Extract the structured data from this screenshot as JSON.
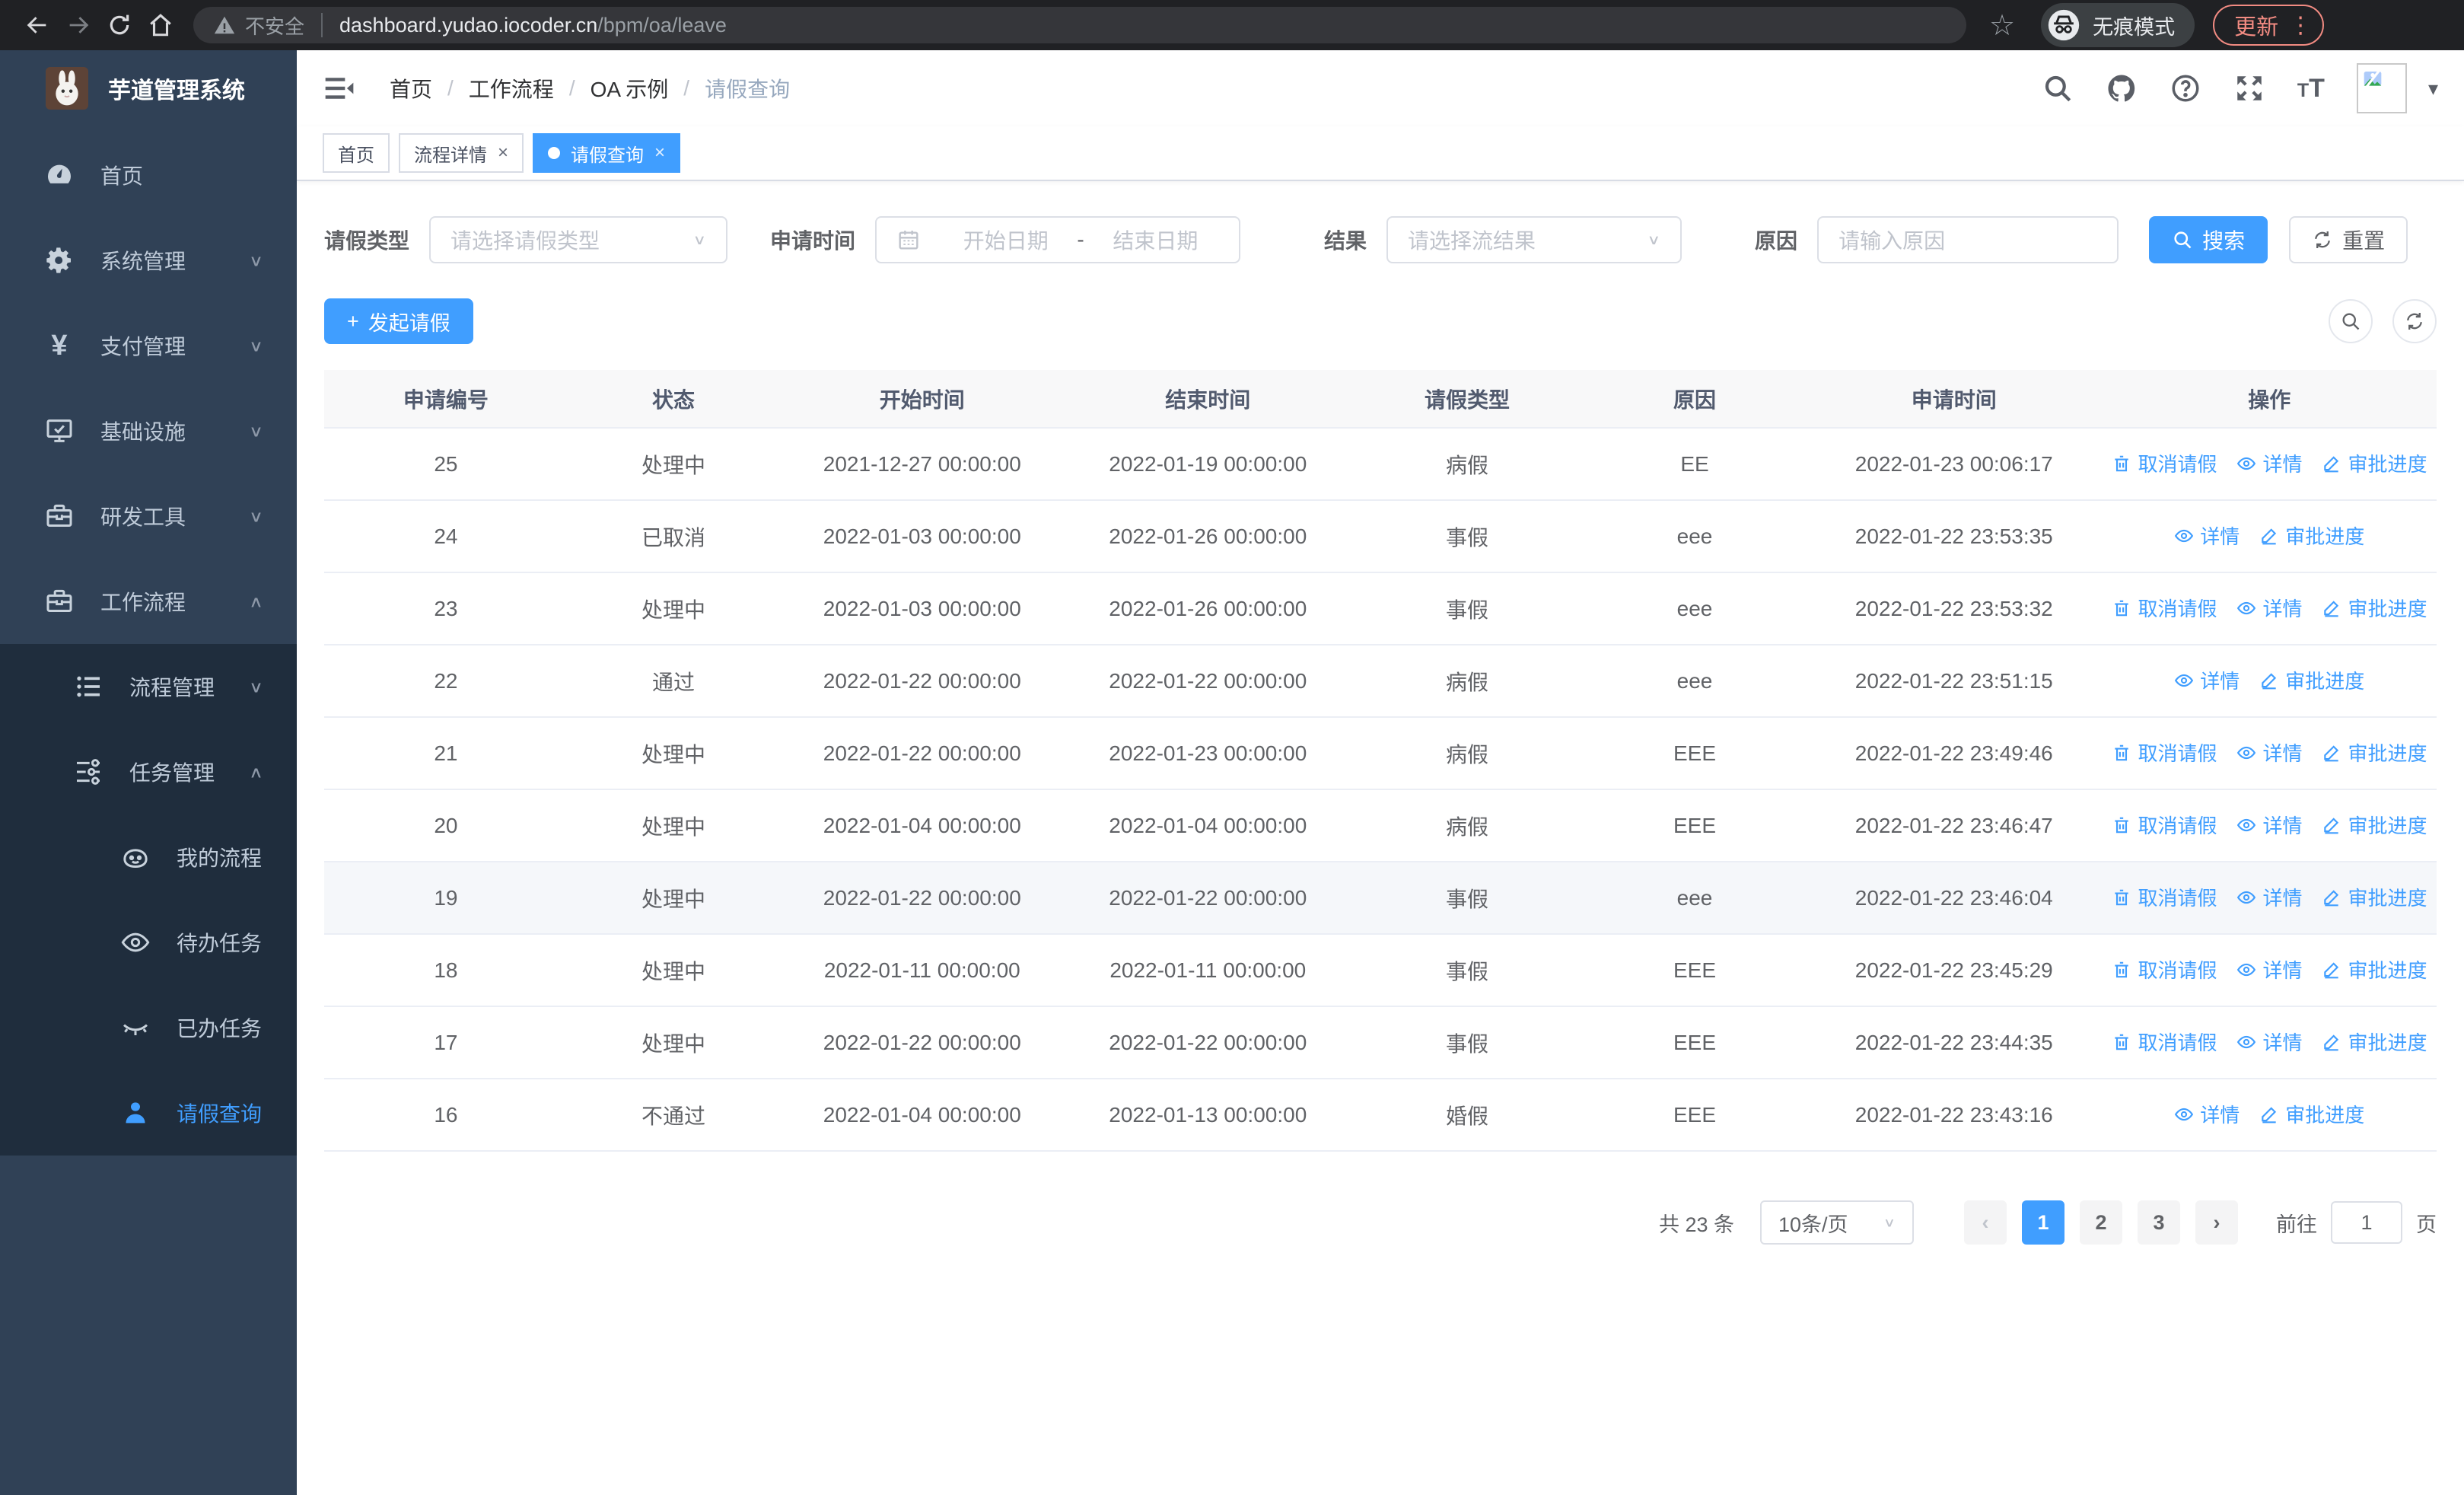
{
  "colors": {
    "accent": "#409eff",
    "sidebar_bg": "#304156",
    "submenu_bg": "#1f2d3d",
    "browser_bg": "#202124",
    "update": "#f28b82",
    "row_hover": "#f5f7fa"
  },
  "browser": {
    "security_label": "不安全",
    "url_host": "dashboard.yudao.iocoder.cn",
    "url_path": "/bpm/oa/leave",
    "incognito_label": "无痕模式",
    "update_label": "更新",
    "icons": [
      "back-icon",
      "forward-icon",
      "reload-icon",
      "home-icon",
      "warning-icon",
      "star-icon",
      "incognito-icon",
      "kebab-menu-icon"
    ]
  },
  "sidebar": {
    "logo_title": "芋道管理系统",
    "logo_icon": "rabbit-logo",
    "items": [
      {
        "label": "首页",
        "icon": "dashboard-icon",
        "depth": 1,
        "arrow": "",
        "sub": false,
        "active": false
      },
      {
        "label": "系统管理",
        "icon": "gear-icon",
        "depth": 1,
        "arrow": "down",
        "sub": false,
        "active": false
      },
      {
        "label": "支付管理",
        "icon": "yen-icon",
        "depth": 1,
        "arrow": "down",
        "sub": false,
        "active": false
      },
      {
        "label": "基础设施",
        "icon": "monitor-icon",
        "depth": 1,
        "arrow": "down",
        "sub": false,
        "active": false
      },
      {
        "label": "研发工具",
        "icon": "toolbox-icon",
        "depth": 1,
        "arrow": "down",
        "sub": false,
        "active": false
      },
      {
        "label": "工作流程",
        "icon": "workflow-icon",
        "depth": 1,
        "arrow": "up",
        "sub": false,
        "active": false
      },
      {
        "label": "流程管理",
        "icon": "process-list-icon",
        "depth": 2,
        "arrow": "down",
        "sub": true,
        "active": false
      },
      {
        "label": "任务管理",
        "icon": "task-flow-icon",
        "depth": 2,
        "arrow": "up",
        "sub": true,
        "active": false
      },
      {
        "label": "我的流程",
        "icon": "robot-face-icon",
        "depth": 3,
        "arrow": "",
        "sub": true,
        "active": false
      },
      {
        "label": "待办任务",
        "icon": "eye-icon",
        "depth": 3,
        "arrow": "",
        "sub": true,
        "active": false
      },
      {
        "label": "已办任务",
        "icon": "eye-closed-icon",
        "depth": 3,
        "arrow": "",
        "sub": true,
        "active": false
      },
      {
        "label": "请假查询",
        "icon": "user-icon",
        "depth": 3,
        "arrow": "",
        "sub": true,
        "active": true
      }
    ]
  },
  "header": {
    "breadcrumb": [
      "首页",
      "工作流程",
      "OA 示例",
      "请假查询"
    ],
    "separator": "/",
    "right_icons": [
      "search-icon",
      "github-icon",
      "help-icon",
      "fullscreen-icon",
      "fontsize-icon",
      "avatar",
      "caret-down-icon"
    ]
  },
  "tabs": [
    {
      "label": "首页",
      "closable": false,
      "active": false
    },
    {
      "label": "流程详情",
      "closable": true,
      "active": false
    },
    {
      "label": "请假查询",
      "closable": true,
      "active": true
    }
  ],
  "filters": {
    "leave_type": {
      "label": "请假类型",
      "placeholder": "请选择请假类型"
    },
    "apply_time": {
      "label": "申请时间",
      "start_placeholder": "开始日期",
      "separator": "-",
      "end_placeholder": "结束日期"
    },
    "result": {
      "label": "结果",
      "placeholder": "请选择流结果"
    },
    "reason": {
      "label": "原因",
      "placeholder": "请输入原因"
    },
    "search_label": "搜索",
    "reset_label": "重置"
  },
  "toolbar": {
    "create_label": "发起请假",
    "plus": "+",
    "icons": [
      "search-circle-icon",
      "refresh-circle-icon"
    ]
  },
  "table": {
    "columns": [
      "申请编号",
      "状态",
      "开始时间",
      "结束时间",
      "请假类型",
      "原因",
      "申请时间",
      "操作"
    ],
    "action_labels": {
      "cancel": "取消请假",
      "detail": "详情",
      "progress": "审批进度"
    },
    "action_icons": {
      "cancel": "trash-icon",
      "detail": "view-eye-icon",
      "progress": "edit-pen-icon"
    },
    "rows": [
      {
        "id": "25",
        "status": "处理中",
        "start": "2021-12-27 00:00:00",
        "end": "2022-01-19 00:00:00",
        "type": "病假",
        "reason": "EE",
        "apply": "2022-01-23 00:06:17",
        "actions": [
          "cancel",
          "detail",
          "progress"
        ],
        "hovered": false
      },
      {
        "id": "24",
        "status": "已取消",
        "start": "2022-01-03 00:00:00",
        "end": "2022-01-26 00:00:00",
        "type": "事假",
        "reason": "eee",
        "apply": "2022-01-22 23:53:35",
        "actions": [
          "detail",
          "progress"
        ],
        "hovered": false
      },
      {
        "id": "23",
        "status": "处理中",
        "start": "2022-01-03 00:00:00",
        "end": "2022-01-26 00:00:00",
        "type": "事假",
        "reason": "eee",
        "apply": "2022-01-22 23:53:32",
        "actions": [
          "cancel",
          "detail",
          "progress"
        ],
        "hovered": false
      },
      {
        "id": "22",
        "status": "通过",
        "start": "2022-01-22 00:00:00",
        "end": "2022-01-22 00:00:00",
        "type": "病假",
        "reason": "eee",
        "apply": "2022-01-22 23:51:15",
        "actions": [
          "detail",
          "progress"
        ],
        "hovered": false
      },
      {
        "id": "21",
        "status": "处理中",
        "start": "2022-01-22 00:00:00",
        "end": "2022-01-23 00:00:00",
        "type": "病假",
        "reason": "EEE",
        "apply": "2022-01-22 23:49:46",
        "actions": [
          "cancel",
          "detail",
          "progress"
        ],
        "hovered": false
      },
      {
        "id": "20",
        "status": "处理中",
        "start": "2022-01-04 00:00:00",
        "end": "2022-01-04 00:00:00",
        "type": "病假",
        "reason": "EEE",
        "apply": "2022-01-22 23:46:47",
        "actions": [
          "cancel",
          "detail",
          "progress"
        ],
        "hovered": false
      },
      {
        "id": "19",
        "status": "处理中",
        "start": "2022-01-22 00:00:00",
        "end": "2022-01-22 00:00:00",
        "type": "事假",
        "reason": "eee",
        "apply": "2022-01-22 23:46:04",
        "actions": [
          "cancel",
          "detail",
          "progress"
        ],
        "hovered": true
      },
      {
        "id": "18",
        "status": "处理中",
        "start": "2022-01-11 00:00:00",
        "end": "2022-01-11 00:00:00",
        "type": "事假",
        "reason": "EEE",
        "apply": "2022-01-22 23:45:29",
        "actions": [
          "cancel",
          "detail",
          "progress"
        ],
        "hovered": false
      },
      {
        "id": "17",
        "status": "处理中",
        "start": "2022-01-22 00:00:00",
        "end": "2022-01-22 00:00:00",
        "type": "事假",
        "reason": "EEE",
        "apply": "2022-01-22 23:44:35",
        "actions": [
          "cancel",
          "detail",
          "progress"
        ],
        "hovered": false
      },
      {
        "id": "16",
        "status": "不通过",
        "start": "2022-01-04 00:00:00",
        "end": "2022-01-13 00:00:00",
        "type": "婚假",
        "reason": "EEE",
        "apply": "2022-01-22 23:43:16",
        "actions": [
          "detail",
          "progress"
        ],
        "hovered": false
      }
    ]
  },
  "pagination": {
    "total_label": "共 23 条",
    "page_size_label": "10条/页",
    "pages": [
      "1",
      "2",
      "3"
    ],
    "active_page": "1",
    "prev_icon": "chevron-left-icon",
    "next_icon": "chevron-right-icon",
    "goto_label": "前往",
    "goto_value": "1",
    "page_unit": "页"
  }
}
